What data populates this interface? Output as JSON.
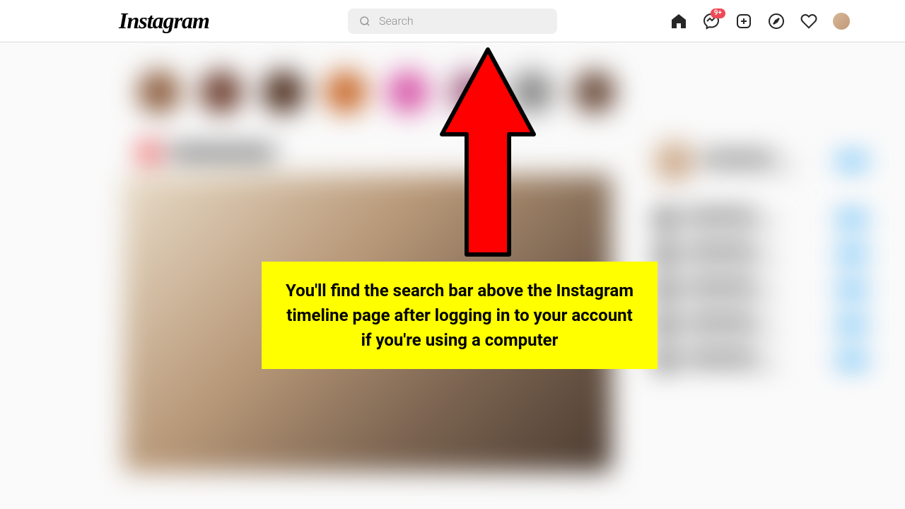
{
  "header": {
    "logo_text": "Instagram",
    "search": {
      "placeholder": "Search"
    },
    "messenger_badge": "9+"
  },
  "stories": [
    {
      "color": "#8a5a3a"
    },
    {
      "color": "#6a3a2a"
    },
    {
      "color": "#4a2a1a"
    },
    {
      "color": "#c8682a"
    },
    {
      "color": "#d858a8"
    },
    {
      "color": "#a8688a"
    },
    {
      "color": "#888"
    },
    {
      "color": "#6a4a3a"
    }
  ],
  "annotation": {
    "text": "You'll find the search bar above the Instagram timeline page after logging in to your account if you're using a computer"
  }
}
